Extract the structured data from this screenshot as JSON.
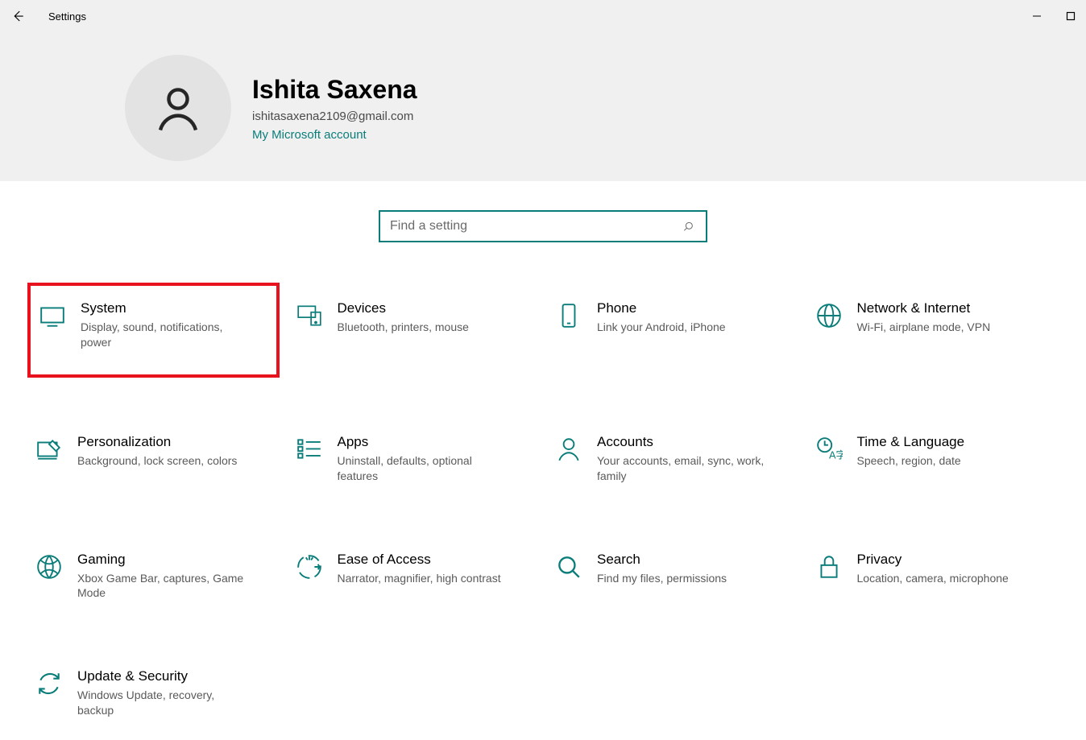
{
  "window": {
    "title": "Settings"
  },
  "user": {
    "display_name": "Ishita Saxena",
    "email": "ishitasaxena2109@gmail.com",
    "account_link": "My Microsoft account"
  },
  "search": {
    "placeholder": "Find a setting"
  },
  "tiles": [
    {
      "title": "System",
      "desc": "Display, sound, notifications, power",
      "highlight": true
    },
    {
      "title": "Devices",
      "desc": "Bluetooth, printers, mouse"
    },
    {
      "title": "Phone",
      "desc": "Link your Android, iPhone"
    },
    {
      "title": "Network & Internet",
      "desc": "Wi-Fi, airplane mode, VPN"
    },
    {
      "title": "Personalization",
      "desc": "Background, lock screen, colors"
    },
    {
      "title": "Apps",
      "desc": "Uninstall, defaults, optional features"
    },
    {
      "title": "Accounts",
      "desc": "Your accounts, email, sync, work, family"
    },
    {
      "title": "Time & Language",
      "desc": "Speech, region, date"
    },
    {
      "title": "Gaming",
      "desc": "Xbox Game Bar, captures, Game Mode"
    },
    {
      "title": "Ease of Access",
      "desc": "Narrator, magnifier, high contrast"
    },
    {
      "title": "Search",
      "desc": "Find my files, permissions"
    },
    {
      "title": "Privacy",
      "desc": "Location, camera, microphone"
    },
    {
      "title": "Update & Security",
      "desc": "Windows Update, recovery, backup"
    }
  ]
}
